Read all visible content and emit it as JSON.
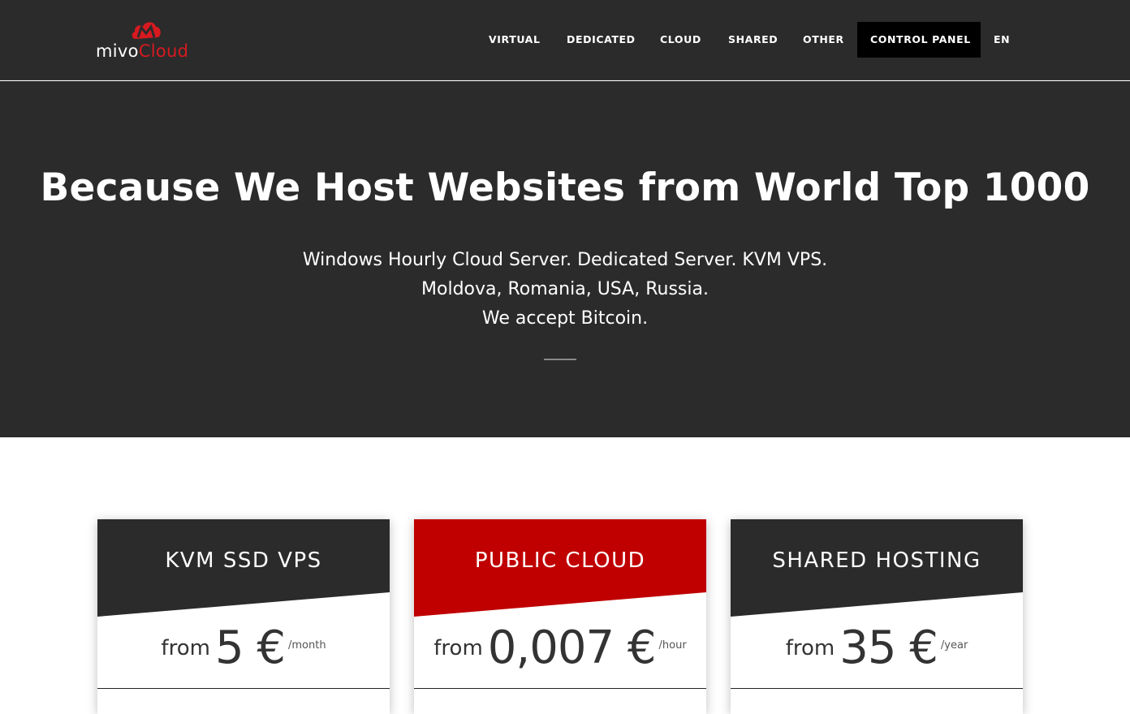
{
  "logo": {
    "part1": "mivo",
    "part2": "Cloud"
  },
  "nav": {
    "items": [
      "VIRTUAL",
      "DEDICATED",
      "CLOUD",
      "SHARED",
      "OTHER"
    ],
    "control_panel": "CONTROL PANEL",
    "language": "EN"
  },
  "hero": {
    "title": "Because We Host Websites from World Top 1000",
    "lines": [
      "Windows Hourly Cloud Server. Dedicated Server. KVM VPS.",
      "Moldova, Romania, USA, Russia.",
      "We accept Bitcoin."
    ]
  },
  "cards": [
    {
      "title": "KVM SSD VPS",
      "from": "from",
      "amount": "5 €",
      "period": "/month",
      "header_color": "#2b2b2b"
    },
    {
      "title": "PUBLIC CLOUD",
      "from": "from",
      "amount": "0,007 €",
      "period": "/hour",
      "header_color": "#c00000"
    },
    {
      "title": "SHARED HOSTING",
      "from": "from",
      "amount": "35 €",
      "period": "/year",
      "header_color": "#2b2b2b"
    }
  ],
  "colors": {
    "dark": "#2b2b2b",
    "brand_red": "#d71920",
    "accent_red": "#c00000"
  }
}
